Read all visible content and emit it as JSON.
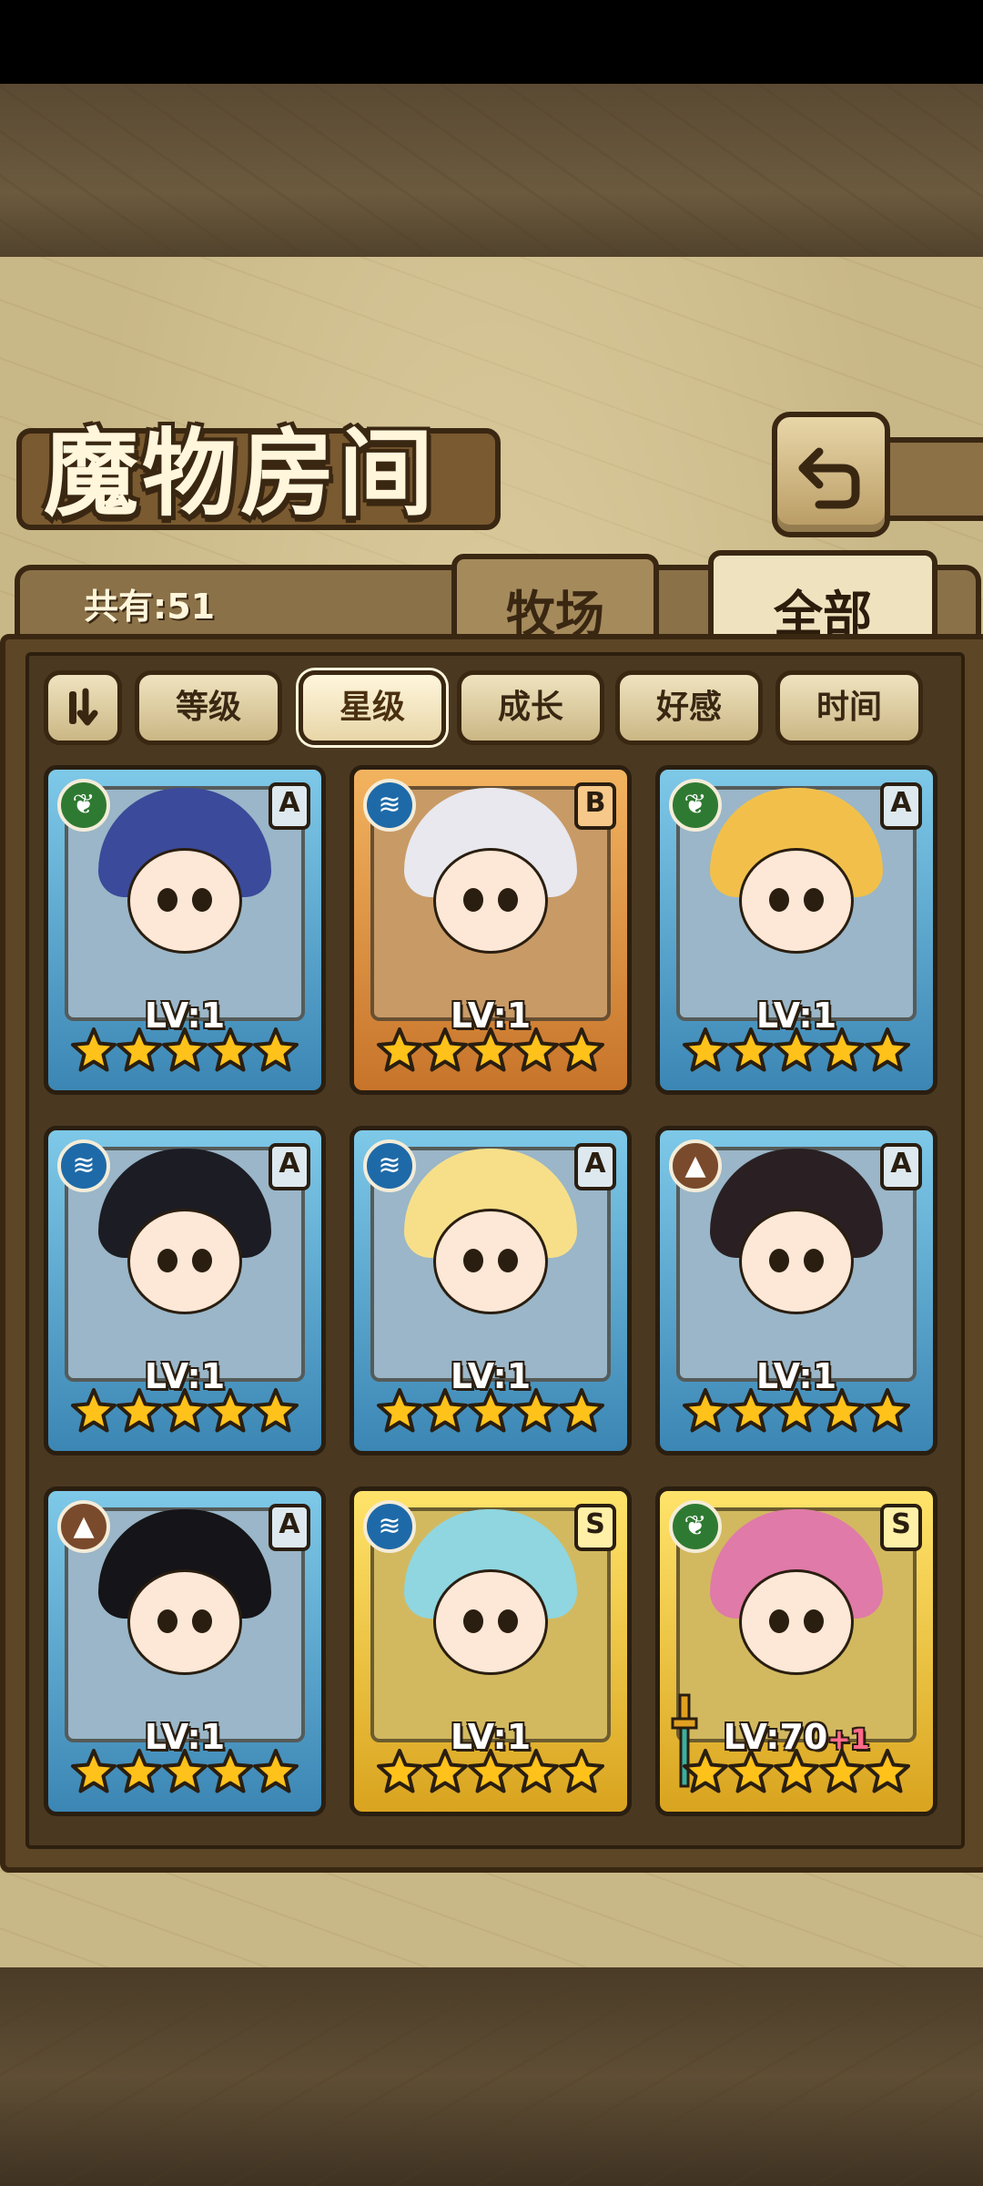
{
  "title": "魔物房间",
  "count_label": "共有:51",
  "tabs": {
    "ranch": "牧场",
    "all": "全部"
  },
  "sort_buttons": [
    "等级",
    "星级",
    "成长",
    "好感",
    "时间"
  ],
  "active_sort": "星级",
  "monsters": [
    {
      "element": "leaf-icon",
      "rank": "A",
      "level": "LV:1",
      "bonus": "",
      "stars": 5,
      "frame": "blue",
      "hair": "#3b4a9a"
    },
    {
      "element": "water-icon",
      "rank": "B",
      "level": "LV:1",
      "bonus": "",
      "stars": 5,
      "frame": "orange",
      "hair": "#e8e8ee"
    },
    {
      "element": "leaf-icon",
      "rank": "A",
      "level": "LV:1",
      "bonus": "",
      "stars": 5,
      "frame": "blue",
      "hair": "#f2c04a"
    },
    {
      "element": "water-icon",
      "rank": "A",
      "level": "LV:1",
      "bonus": "",
      "stars": 5,
      "frame": "blue",
      "hair": "#1c1c24"
    },
    {
      "element": "water-icon",
      "rank": "A",
      "level": "LV:1",
      "bonus": "",
      "stars": 5,
      "frame": "blue",
      "hair": "#f7df8a"
    },
    {
      "element": "earth-icon",
      "rank": "A",
      "level": "LV:1",
      "bonus": "",
      "stars": 5,
      "frame": "blue",
      "hair": "#2a2024"
    },
    {
      "element": "earth-icon",
      "rank": "A",
      "level": "LV:1",
      "bonus": "",
      "stars": 5,
      "frame": "blue",
      "hair": "#151418"
    },
    {
      "element": "water-icon",
      "rank": "S",
      "level": "LV:1",
      "bonus": "",
      "stars": 5,
      "frame": "gold",
      "hair": "#8fd6e0"
    },
    {
      "element": "leaf-icon",
      "rank": "S",
      "level": "LV:70",
      "bonus": "+1",
      "stars": 5,
      "frame": "gold",
      "hair": "#e07aa8"
    }
  ],
  "colors": {
    "parchment": "#c9b887",
    "frame_dark": "#3a2712",
    "star": "#ffc21a"
  }
}
